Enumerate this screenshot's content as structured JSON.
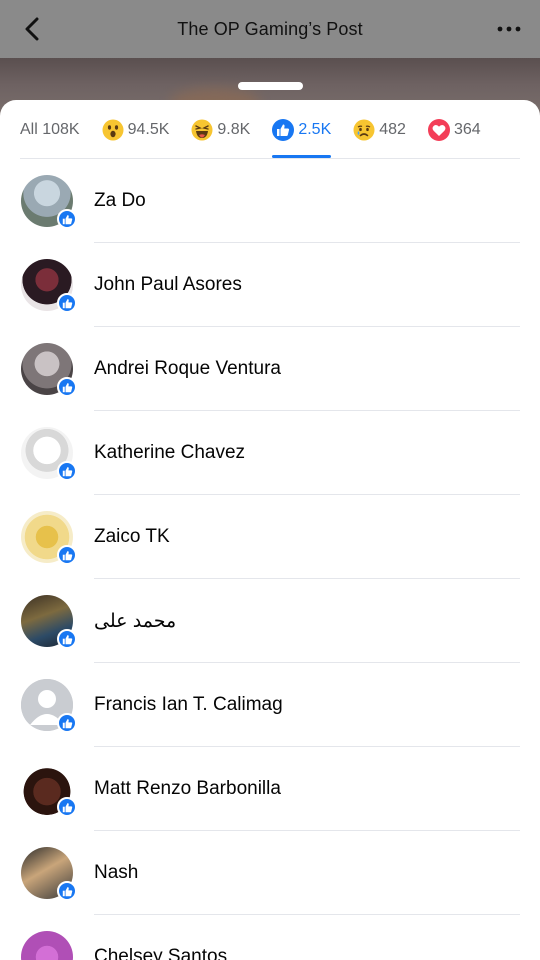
{
  "header": {
    "title": "The OP Gaming’s Post"
  },
  "tabs": [
    {
      "name": "all",
      "label": "All 108K",
      "emoji": null
    },
    {
      "name": "wow",
      "label": "94.5K",
      "emoji": "wow-emoji-icon"
    },
    {
      "name": "haha",
      "label": "9.8K",
      "emoji": "haha-emoji-icon"
    },
    {
      "name": "like",
      "label": "2.5K",
      "emoji": "like-icon",
      "active": true
    },
    {
      "name": "sad",
      "label": "482",
      "emoji": "sad-emoji-icon"
    },
    {
      "name": "love",
      "label": "364",
      "emoji": "love-icon"
    }
  ],
  "people": [
    {
      "name": "Za Do"
    },
    {
      "name": "John Paul Asores"
    },
    {
      "name": "Andrei Roque Ventura"
    },
    {
      "name": "Katherine Chavez"
    },
    {
      "name": "Zaico TK"
    },
    {
      "name": "محمد على"
    },
    {
      "name": "Francis Ian T. Calimag"
    },
    {
      "name": "Matt Renzo Barbonilla"
    },
    {
      "name": "Nash"
    },
    {
      "name": "Chelsey Santos"
    }
  ],
  "colors": {
    "accent": "#1877f2",
    "inactive_text": "#65676b",
    "divider": "#e4e6eb",
    "header_dim": "#8a8a8a"
  }
}
